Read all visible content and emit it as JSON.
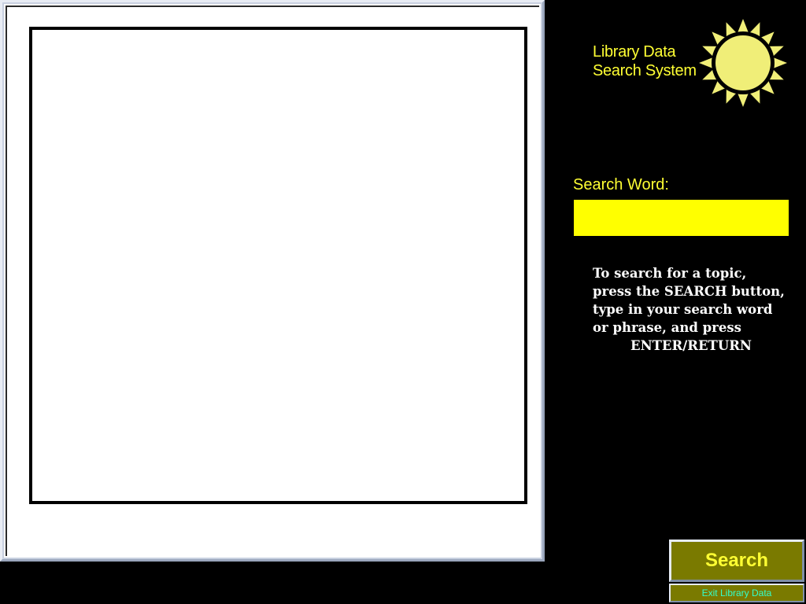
{
  "app": {
    "title_line1": "Library Data",
    "title_line2": "Search System",
    "logo_icon": "sun-icon"
  },
  "search": {
    "label": "Search Word:",
    "value": "",
    "placeholder": ""
  },
  "instructions": {
    "lines": [
      "To search for a topic,",
      "press the SEARCH button,",
      "type in your  search word",
      "or phrase, and  press",
      "ENTER/RETURN"
    ]
  },
  "buttons": {
    "search_label": "Search",
    "exit_label": "Exit Library Data"
  },
  "colors": {
    "background": "#000000",
    "accent_yellow": "#ffff33",
    "field_yellow": "#ffff00",
    "button_olive": "#7a7a00",
    "exit_text": "#33ffcc"
  }
}
